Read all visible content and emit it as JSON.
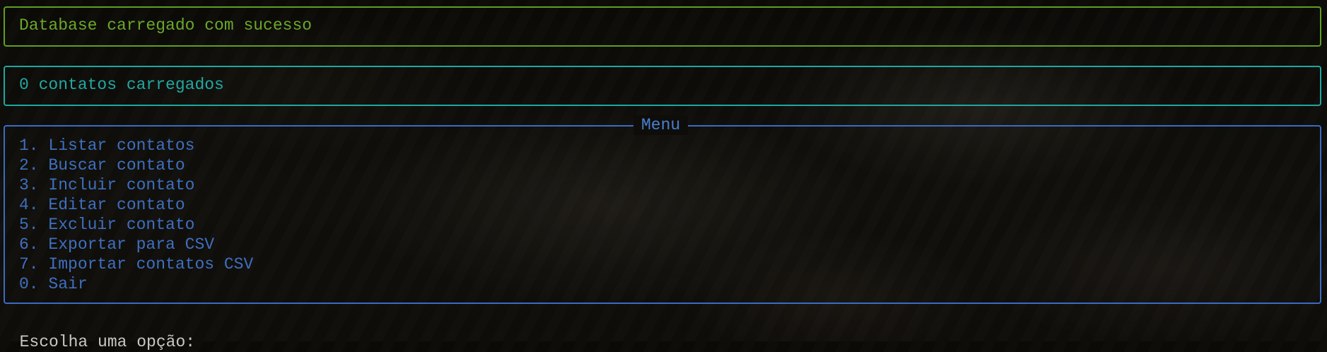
{
  "status": {
    "message": "Database carregado com sucesso"
  },
  "contacts": {
    "message": "0 contatos carregados"
  },
  "menu": {
    "title": "Menu",
    "items": [
      {
        "label": "1. Listar contatos"
      },
      {
        "label": "2. Buscar contato"
      },
      {
        "label": "3. Incluir contato"
      },
      {
        "label": "4. Editar contato"
      },
      {
        "label": "5. Excluir contato"
      },
      {
        "label": "6. Exportar para CSV"
      },
      {
        "label": "7. Importar contatos CSV"
      },
      {
        "label": "0. Sair"
      }
    ]
  },
  "prompt": {
    "text": "Escolha uma opção:"
  },
  "colors": {
    "status_border": "#5f9f1f",
    "count_border": "#1ea7a0",
    "menu_border": "#3a6cc4",
    "prompt_text": "#c8c8c0"
  }
}
